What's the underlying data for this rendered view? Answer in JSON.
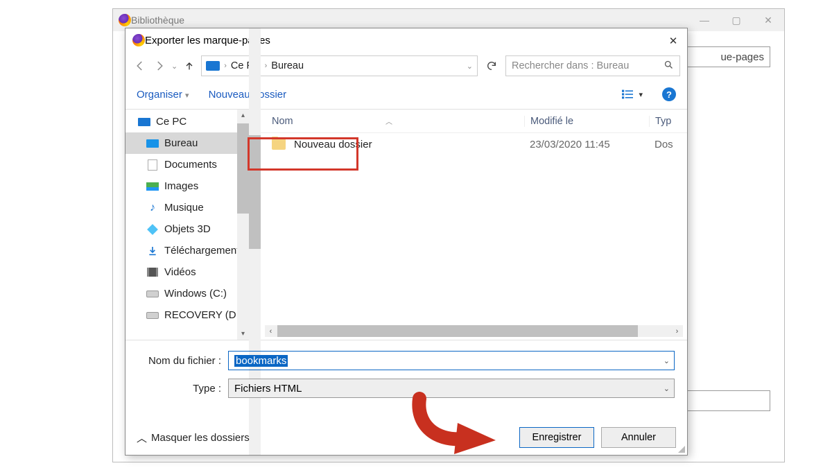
{
  "bg": {
    "title": "Bibliothèque",
    "header_input_tail": "ue-pages"
  },
  "dialog": {
    "title": "Exporter les marque-pages",
    "path": {
      "root": "Ce PC",
      "current": "Bureau"
    },
    "search_placeholder": "Rechercher dans : Bureau",
    "toolbar": {
      "organize": "Organiser",
      "new_folder": "Nouveau dossier"
    },
    "tree": [
      {
        "label": "Ce PC",
        "icon": "pc"
      },
      {
        "label": "Bureau",
        "icon": "desktop",
        "selected": true
      },
      {
        "label": "Documents",
        "icon": "doc"
      },
      {
        "label": "Images",
        "icon": "img"
      },
      {
        "label": "Musique",
        "icon": "music"
      },
      {
        "label": "Objets 3D",
        "icon": "obj3d"
      },
      {
        "label": "Téléchargements",
        "icon": "dl"
      },
      {
        "label": "Vidéos",
        "icon": "video"
      },
      {
        "label": "Windows (C:)",
        "icon": "drive"
      },
      {
        "label": "RECOVERY (D:)",
        "icon": "drive"
      }
    ],
    "columns": {
      "name": "Nom",
      "modified": "Modifié le",
      "type": "Typ"
    },
    "rows": [
      {
        "name": "Nouveau dossier",
        "modified": "23/03/2020 11:45",
        "type": "Dos"
      }
    ],
    "form": {
      "filename_label": "Nom du fichier :",
      "filename_value": "bookmarks",
      "type_label": "Type :",
      "type_value": "Fichiers HTML"
    },
    "footer": {
      "hide_folders": "Masquer les dossiers",
      "save": "Enregistrer",
      "cancel": "Annuler"
    }
  }
}
